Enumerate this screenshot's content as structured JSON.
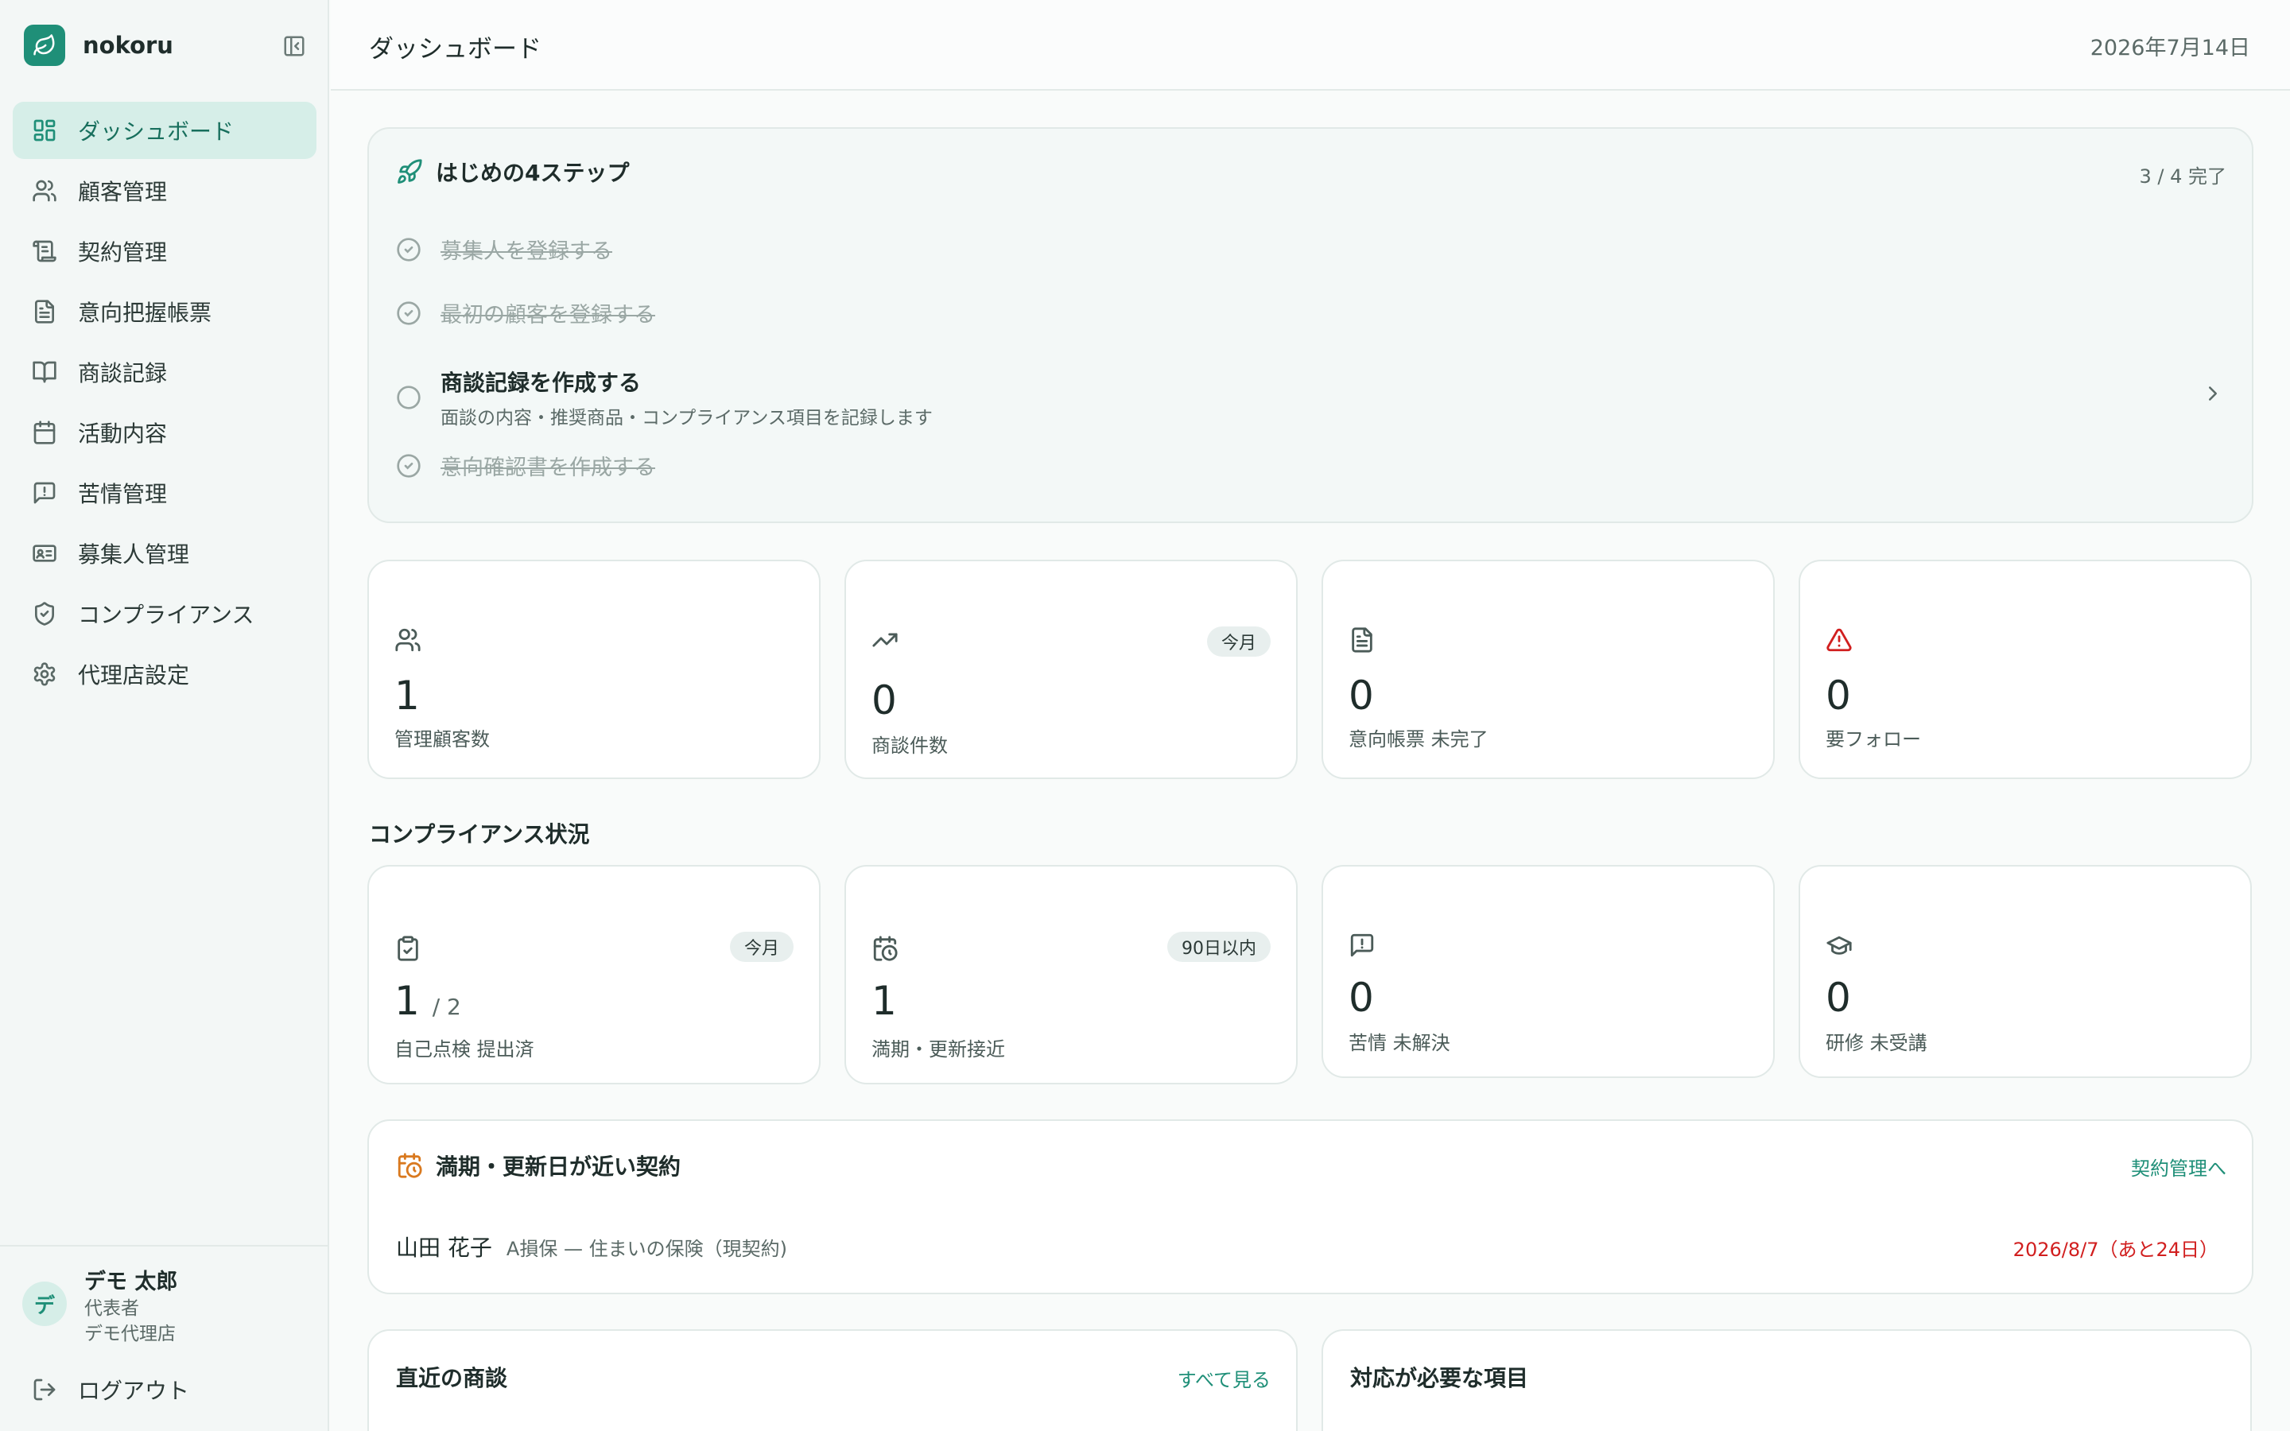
{
  "app": {
    "name": "nokoru"
  },
  "sidebar": {
    "items": [
      {
        "label": "ダッシュボード",
        "icon": "dashboard-icon"
      },
      {
        "label": "顧客管理",
        "icon": "users-icon"
      },
      {
        "label": "契約管理",
        "icon": "scroll-icon"
      },
      {
        "label": "意向把握帳票",
        "icon": "document-icon"
      },
      {
        "label": "商談記録",
        "icon": "book-icon"
      },
      {
        "label": "活動内容",
        "icon": "calendar-icon"
      },
      {
        "label": "苦情管理",
        "icon": "alert-message-icon"
      },
      {
        "label": "募集人管理",
        "icon": "id-card-icon"
      },
      {
        "label": "コンプライアンス",
        "icon": "shield-check-icon"
      },
      {
        "label": "代理店設定",
        "icon": "gear-icon"
      }
    ],
    "user": {
      "avatar": "デ",
      "name": "デモ 太郎",
      "role": "代表者",
      "agency": "デモ代理店"
    },
    "logout": "ログアウト"
  },
  "header": {
    "title": "ダッシュボード",
    "date": "2026年7月14日"
  },
  "steps": {
    "title": "はじめの4ステップ",
    "progress": "3 / 4 完了",
    "items": [
      {
        "label": "募集人を登録する",
        "done": true
      },
      {
        "label": "最初の顧客を登録する",
        "done": true
      },
      {
        "label": "商談記録を作成する",
        "sub": "面談の内容・推奨商品・コンプライアンス項目を記録します",
        "done": false
      },
      {
        "label": "意向確認書を作成する",
        "done": true
      }
    ]
  },
  "stats": [
    {
      "value": "1",
      "label": "管理顧客数",
      "icon": "users-icon"
    },
    {
      "value": "0",
      "label": "商談件数",
      "badge": "今月",
      "icon": "trending-up-icon"
    },
    {
      "value": "0",
      "label": "意向帳票 未完了",
      "icon": "document-icon"
    },
    {
      "value": "0",
      "label": "要フォロー",
      "icon": "warning-triangle-icon",
      "icon_color": "#d11f1f"
    }
  ],
  "compliance": {
    "title": "コンプライアンス状況",
    "cards": [
      {
        "value": "1",
        "of": "/ 2",
        "label": "自己点検 提出済",
        "badge": "今月",
        "icon": "clipboard-check-icon",
        "value_color": "#b5661a"
      },
      {
        "value": "1",
        "label": "満期・更新接近",
        "badge": "90日以内",
        "icon": "calendar-clock-icon",
        "value_color": "#b5661a"
      },
      {
        "value": "0",
        "label": "苦情 未解決",
        "icon": "alert-message-icon"
      },
      {
        "value": "0",
        "label": "研修 未受講",
        "icon": "graduation-cap-icon"
      }
    ]
  },
  "renewals": {
    "title": "満期・更新日が近い契約",
    "link": "契約管理へ",
    "rows": [
      {
        "name": "山田 花子",
        "desc": "A損保 — 住まいの保険（現契約)",
        "date": "2026/8/7（あと24日）"
      }
    ]
  },
  "recent": {
    "title": "直近の商談",
    "link": "すべて見る"
  },
  "todo": {
    "title": "対応が必要な項目"
  }
}
